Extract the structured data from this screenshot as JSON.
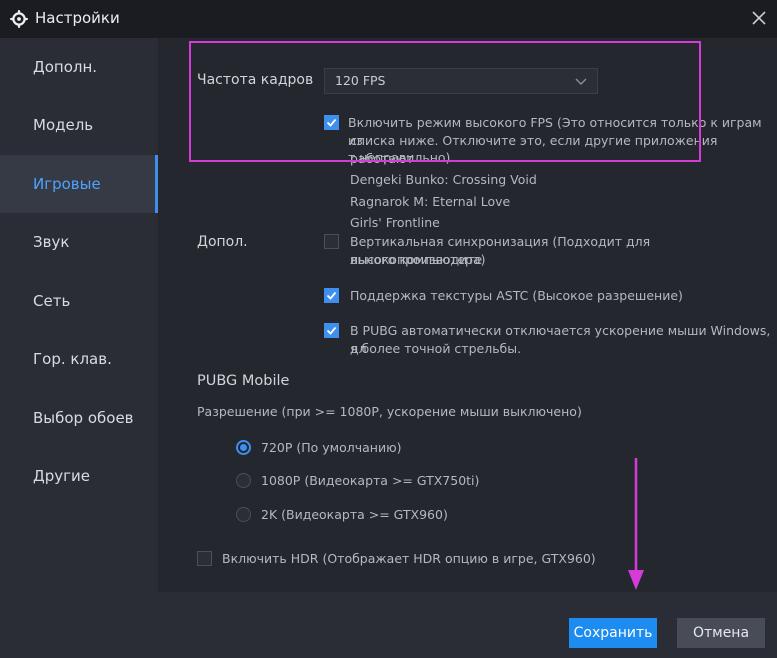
{
  "window": {
    "title": "Настройки"
  },
  "sidebar": {
    "items": [
      {
        "label": "Дополн."
      },
      {
        "label": "Модель"
      },
      {
        "label": "Игровые"
      },
      {
        "label": "Звук"
      },
      {
        "label": "Сеть"
      },
      {
        "label": "Гор. клав."
      },
      {
        "label": "Выбор обоев"
      },
      {
        "label": "Другие"
      }
    ],
    "active_index": 2
  },
  "fps": {
    "label": "Частота кадров",
    "selected": "120 FPS",
    "high_fps_checkbox": {
      "checked": true,
      "line1": "Включить режим высокого FPS (Это относится только к играм из",
      "line2": "списка ниже. Отключите это, если другие приложения работают",
      "line3": "т неправильно)"
    },
    "games": [
      "Dengeki Bunko: Crossing Void",
      "Ragnarok M: Eternal Love",
      "Girls' Frontline"
    ]
  },
  "extra": {
    "label": "Допол.",
    "vsync": {
      "checked": false,
      "line1": "Вертикальная синхронизация (Подходит для высокопроизводите",
      "line2": "льного компьютера)"
    },
    "astc": {
      "checked": true,
      "text": "Поддержка текстуры ASTC (Высокое разрешение)"
    },
    "pubg_mouse": {
      "checked": true,
      "line1": "В PUBG автоматически отключается ускорение мыши Windows, дл",
      "line2": "я более точной стрельбы."
    }
  },
  "pubg": {
    "title": "PUBG Mobile",
    "resolution_label": "Разрешение (при >= 1080P, ускорение мыши выключено)",
    "options": [
      {
        "label": "720P (По умолчанию)",
        "selected": true
      },
      {
        "label": "1080P (Видеокарта >= GTX750ti)",
        "selected": false
      },
      {
        "label": "2K (Видеокарта >= GTX960)",
        "selected": false
      }
    ],
    "hdr": {
      "checked": false,
      "text": "Включить HDR (Отображает HDR опцию в игре, GTX960)"
    }
  },
  "footer": {
    "save_label": "Сохранить",
    "cancel_label": "Отмена"
  },
  "colors": {
    "accent": "#3d8ff0",
    "annotation": "#d53cd7"
  }
}
